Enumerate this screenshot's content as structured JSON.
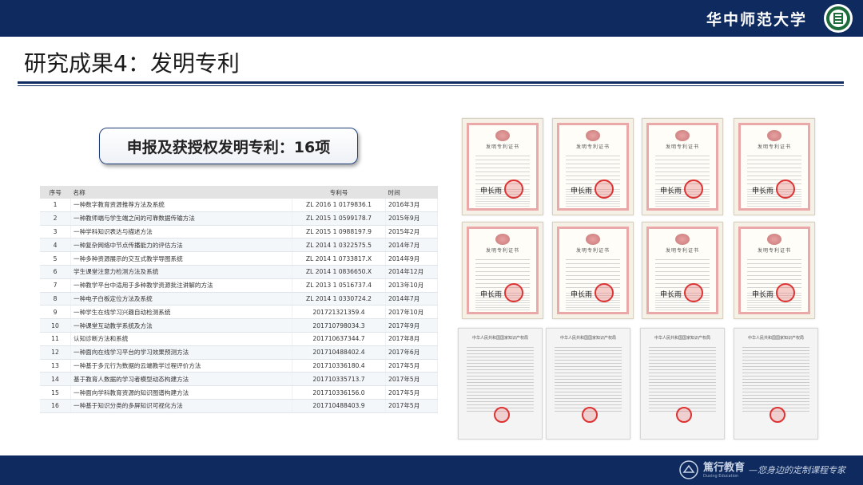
{
  "header": {
    "university_name": "华中师范大学",
    "logo_icon": "university-emblem-icon"
  },
  "slide": {
    "title": "研究成果4：发明专利",
    "headline": "申报及获授权发明专利：16项"
  },
  "table": {
    "columns": [
      "序号",
      "名称",
      "专利号",
      "时间"
    ],
    "rows": [
      {
        "no": "1",
        "name": "一种数字教育资源推荐方法及系统",
        "patent_no": "ZL 2016 1 0179836.1",
        "date": "2016年3月"
      },
      {
        "no": "2",
        "name": "一种教师端与学生端之间的可靠数据传输方法",
        "patent_no": "ZL 2015 1 0599178.7",
        "date": "2015年9月"
      },
      {
        "no": "3",
        "name": "一种学科知识表达与描述方法",
        "patent_no": "ZL 2015 1 0988197.9",
        "date": "2015年2月"
      },
      {
        "no": "4",
        "name": "一种复杂网络中节点传播能力的评估方法",
        "patent_no": "ZL 2014 1 0322575.5",
        "date": "2014年7月"
      },
      {
        "no": "5",
        "name": "一种多种资源展示的交互式教学导图系统",
        "patent_no": "ZL 2014 1 0733817.X",
        "date": "2014年9月"
      },
      {
        "no": "6",
        "name": "学生课堂注意力检测方法及系统",
        "patent_no": "ZL 2014 1 0836650.X",
        "date": "2014年12月"
      },
      {
        "no": "7",
        "name": "一种教学平台中适用于多种教学资源批注讲解的方法",
        "patent_no": "ZL 2013 1 0516737.4",
        "date": "2013年10月"
      },
      {
        "no": "8",
        "name": "一种电子白板定位方法及系统",
        "patent_no": "ZL 2014 1 0330724.2",
        "date": "2014年7月"
      },
      {
        "no": "9",
        "name": "一种学生在线学习兴趣自动检测系统",
        "patent_no": "201721321359.4",
        "date": "2017年10月"
      },
      {
        "no": "10",
        "name": "一种课堂互动教学系统及方法",
        "patent_no": "201710798034.3",
        "date": "2017年9月"
      },
      {
        "no": "11",
        "name": "认知诊断方法和系统",
        "patent_no": "201710637344.7",
        "date": "2017年8月"
      },
      {
        "no": "12",
        "name": "一种面向在线学习平台的学习效果预测方法",
        "patent_no": "201710488402.4",
        "date": "2017年6月"
      },
      {
        "no": "13",
        "name": "一种基于多元行为数据的云端教学过程评价方法",
        "patent_no": "201710336180.4",
        "date": "2017年5月"
      },
      {
        "no": "14",
        "name": "基于教育人数据的学习者模型动态构建方法",
        "patent_no": "201710335713.7",
        "date": "2017年5月"
      },
      {
        "no": "15",
        "name": "一种面向学科教育资源的知识图谱构建方法",
        "patent_no": "201710336156.0",
        "date": "2017年5月"
      },
      {
        "no": "16",
        "name": "一种基于知识分类的多屏知识可视化方法",
        "patent_no": "201710488403.9",
        "date": "2017年5月"
      }
    ]
  },
  "certificates": {
    "invention_title": "发明专利证书",
    "signature": "申长雨",
    "grey_header": "中华人民共和国国家知识产权局"
  },
  "footer": {
    "brand": "篤行教育",
    "brand_en": "Duxing Education",
    "slogan": "—您身边的定制课程专家"
  }
}
